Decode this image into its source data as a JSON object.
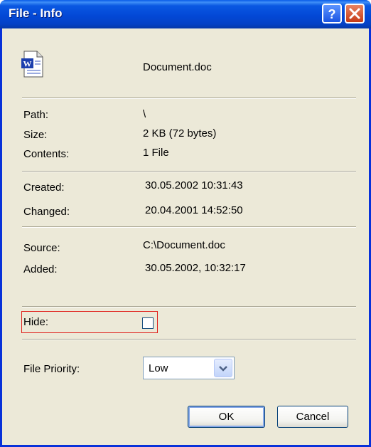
{
  "window": {
    "title": "File - Info"
  },
  "titlebar": {
    "help_icon": "help-icon",
    "close_icon": "close-icon"
  },
  "file": {
    "icon": "word-document-icon",
    "name": "Document.doc"
  },
  "info": {
    "path_label": "Path:",
    "path_value": "\\",
    "size_label": "Size:",
    "size_value": "2 KB (72 bytes)",
    "contents_label": "Contents:",
    "contents_value": "1 File",
    "created_label": "Created:",
    "created_value": "30.05.2002 10:31:43",
    "changed_label": "Changed:",
    "changed_value": "20.04.2001 14:52:50",
    "source_label": "Source:",
    "source_value": "C:\\Document.doc",
    "added_label": "Added:",
    "added_value": "30.05.2002, 10:32:17"
  },
  "hide": {
    "label": "Hide:",
    "checked": false
  },
  "priority": {
    "label": "File Priority:",
    "selected": "Low"
  },
  "buttons": {
    "ok": "OK",
    "cancel": "Cancel"
  },
  "colors": {
    "titlebar": "#0348d6",
    "highlight_border": "#e0201b",
    "dialog_bg": "#ece9d8"
  }
}
